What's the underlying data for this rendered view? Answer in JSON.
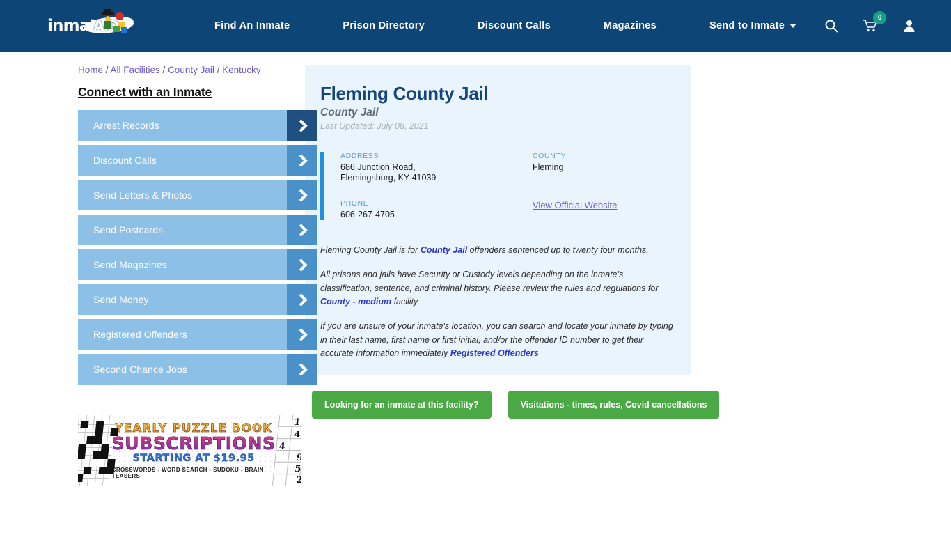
{
  "header": {
    "logo_text": "inmate",
    "logo_text2": "AID",
    "nav": [
      {
        "label": "Find An Inmate"
      },
      {
        "label": "Prison Directory"
      },
      {
        "label": "Discount Calls"
      },
      {
        "label": "Magazines"
      },
      {
        "label": "Send to Inmate"
      }
    ],
    "search_icon": "search-icon",
    "cart_icon": "shopping-cart-icon",
    "cart_count": "0",
    "account_icon": "user-account-icon",
    "bg_color": "#0d4577",
    "badge_color": "#16a085"
  },
  "breadcrumb": {
    "items": [
      "Home",
      "All Facilities",
      "County Jail",
      "Kentucky"
    ],
    "separator": "/"
  },
  "sidebar": {
    "title": "Connect with an Inmate",
    "items": [
      {
        "label": "Arrest Records",
        "active": true
      },
      {
        "label": "Discount Calls",
        "active": false
      },
      {
        "label": "Send Letters & Photos",
        "active": false
      },
      {
        "label": "Send Postcards",
        "active": false
      },
      {
        "label": "Send Magazines",
        "active": false
      },
      {
        "label": "Send Money",
        "active": false
      },
      {
        "label": "Registered Offenders",
        "active": false
      },
      {
        "label": "Second Chance Jobs",
        "active": false
      }
    ],
    "button_color": "#8dc0e7",
    "arrow_color": "#4a90c9",
    "arrow_active_color": "#1f5080"
  },
  "ad": {
    "line1": "YEARLY PUZZLE BOOK",
    "line2": "SUBSCRIPTIONS",
    "line3": "STARTING AT $19.95",
    "line4": "CROSSWORDS - WORD SEARCH - SUDOKU - BRAIN TEASERS",
    "sudoku_numbers": [
      "1",
      "4",
      "4",
      "9",
      "5",
      "2"
    ]
  },
  "facility": {
    "name": "Fleming County Jail",
    "type": "County Jail",
    "last_updated": "Last Updated: July 08, 2021",
    "address_label": "ADDRESS",
    "address_value": "686 Junction Road, Flemingsburg, KY 41039",
    "county_label": "COUNTY",
    "county_value": "Fleming",
    "phone_label": "PHONE",
    "phone_value": "606-267-4705",
    "website_link": "View Official Website",
    "accent_color": "#1e8fe1",
    "card_bg": "#eaf4fc"
  },
  "description": {
    "p1_a": "Fleming County Jail is for ",
    "p1_link": "County Jail",
    "p1_b": " offenders sentenced up to twenty four months.",
    "p2_a": "All prisons and jails have Security or Custody levels depending on the inmate's classification, sentence, and criminal history. Please review the rules and regulations for ",
    "p2_link": "County - medium",
    "p2_b": " facility.",
    "p3_a": "If you are unsure of your inmate's location, you can search and locate your inmate by typing in their last name, first name or first initial, and/or the offender ID number to get their accurate information immediately ",
    "p3_link": "Registered Offenders"
  },
  "cta": {
    "button1": "Looking for an inmate at this facility?",
    "button2": "Visitations - times, rules, Covid cancellations",
    "color": "#4aa845"
  }
}
